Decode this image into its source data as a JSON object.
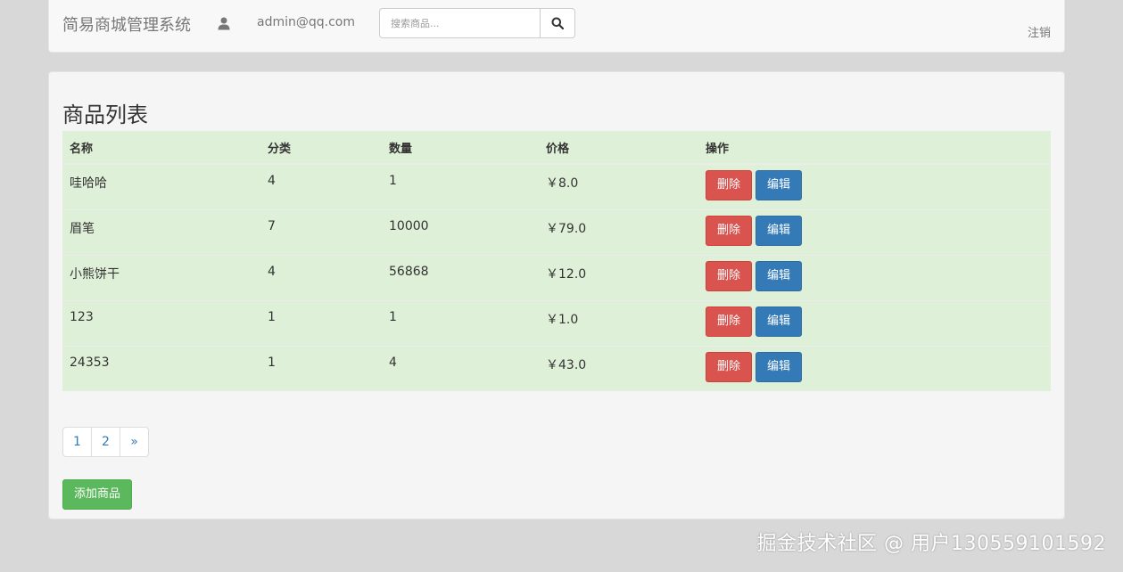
{
  "navbar": {
    "brand": "简易商城管理系统",
    "user_email": "admin@qq.com",
    "search_placeholder": "搜索商品...",
    "logout_label": "注销",
    "user_icon": "user-icon",
    "search_icon": "search-icon"
  },
  "main": {
    "title": "商品列表",
    "table": {
      "headers": [
        "名称",
        "分类",
        "数量",
        "价格",
        "操作"
      ],
      "rows": [
        {
          "name": "哇哈哈",
          "category": "4",
          "quantity": "1",
          "price": "￥8.0"
        },
        {
          "name": "眉笔",
          "category": "7",
          "quantity": "10000",
          "price": "￥79.0"
        },
        {
          "name": "小熊饼干",
          "category": "4",
          "quantity": "56868",
          "price": "￥12.0"
        },
        {
          "name": "123",
          "category": "1",
          "quantity": "1",
          "price": "￥1.0"
        },
        {
          "name": "24353",
          "category": "1",
          "quantity": "4",
          "price": "￥43.0"
        }
      ],
      "delete_label": "删除",
      "edit_label": "编辑"
    },
    "pagination": [
      "1",
      "2",
      "»"
    ],
    "add_button_label": "添加商品"
  },
  "watermark": "掘金技术社区 @ 用户130559101592",
  "colors": {
    "danger": "#d9534f",
    "primary": "#337ab7",
    "success": "#5cb85c",
    "row_bg": "#dff0d8"
  }
}
